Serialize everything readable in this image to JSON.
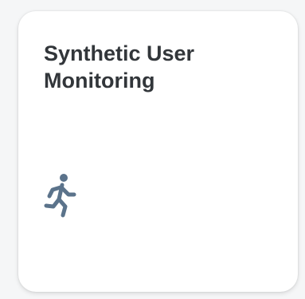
{
  "tile": {
    "title": "Synthetic User Monitoring",
    "icon": "running-person-icon"
  },
  "colors": {
    "background": "#f5f6f7",
    "tile_background": "#ffffff",
    "title_text": "#32363a",
    "icon": "#5b738b"
  }
}
